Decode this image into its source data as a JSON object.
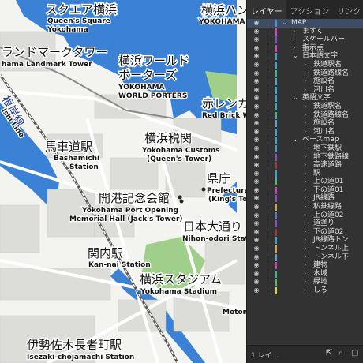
{
  "map": {
    "labels": [
      {
        "id": "queens-square-jp",
        "text": "スクエア横浜",
        "cls": "jp"
      },
      {
        "id": "queens-square-en",
        "text": "Queen's Square",
        "cls": "en"
      },
      {
        "id": "queens-square-en2",
        "text": "Yokohama",
        "cls": "en"
      },
      {
        "id": "landmark-jp",
        "text": "ランドマークタワー",
        "cls": "jp"
      },
      {
        "id": "landmark-en",
        "text": "hama Landmark Tower",
        "cls": "en"
      },
      {
        "id": "world-porters-jp",
        "text": "横浜ワールド",
        "cls": "jp"
      },
      {
        "id": "world-porters-jp2",
        "text": "ポーターズ",
        "cls": "jp"
      },
      {
        "id": "world-porters-en",
        "text": "YOKOHAMA",
        "cls": "en"
      },
      {
        "id": "world-porters-en2",
        "text": "WORLD PORTERS",
        "cls": "en"
      },
      {
        "id": "hammer-jp",
        "text": "横浜ハン",
        "cls": "jp"
      },
      {
        "id": "hammer-en",
        "text": "YOKOHAMA HAN",
        "cls": "en"
      },
      {
        "id": "redbrick-jp",
        "text": "赤レンガ",
        "cls": "jp"
      },
      {
        "id": "redbrick-en",
        "text": "Red Brick W",
        "cls": "en"
      },
      {
        "id": "line-jp",
        "text": "根岸線",
        "cls": "line"
      },
      {
        "id": "line-en",
        "text": "ishi Line",
        "cls": "en"
      },
      {
        "id": "bashamichi-jp",
        "text": "馬車道駅",
        "cls": "jp"
      },
      {
        "id": "bashamichi-en",
        "text": "Bashamichi",
        "cls": "en"
      },
      {
        "id": "bashamichi-en2",
        "text": "Station",
        "cls": "en"
      },
      {
        "id": "customs-jp",
        "text": "横浜税関",
        "cls": "jp"
      },
      {
        "id": "customs-en",
        "text": "Yokohama Customs",
        "cls": "en"
      },
      {
        "id": "customs-en2",
        "text": "(Queen's Tower)",
        "cls": "en"
      },
      {
        "id": "pref-jp",
        "text": "県庁",
        "cls": "jp"
      },
      {
        "id": "pref-en",
        "text": "Prefectura",
        "cls": "en"
      },
      {
        "id": "pref-en2",
        "text": "(King's Tow",
        "cls": "en"
      },
      {
        "id": "memorial-jp",
        "text": "開港記念会館",
        "cls": "jp"
      },
      {
        "id": "memorial-en",
        "text": "Yokohama Port Opening",
        "cls": "en"
      },
      {
        "id": "memorial-en2",
        "text": "Memorial Hall (Jack's Tower)",
        "cls": "en"
      },
      {
        "id": "nihon-odori-jp",
        "text": "日本大通り",
        "cls": "jp"
      },
      {
        "id": "nihon-odori-en",
        "text": "Nihon-odori Station",
        "cls": "en"
      },
      {
        "id": "kannai-jp",
        "text": "関内駅",
        "cls": "jp"
      },
      {
        "id": "kannai-en",
        "text": "Kan-nai Station",
        "cls": "en"
      },
      {
        "id": "stadium-jp",
        "text": "横浜スタジアム",
        "cls": "jp"
      },
      {
        "id": "stadium-en",
        "text": "Yokohama Stadium",
        "cls": "en"
      },
      {
        "id": "isezaki-jp",
        "text": "伊勢佐木長者町駅",
        "cls": "jp"
      },
      {
        "id": "isezaki-en",
        "text": "Isezaki-chojamachi Station",
        "cls": "en"
      },
      {
        "id": "motomachi-en",
        "text": "Motom",
        "cls": "en"
      }
    ]
  },
  "panel": {
    "tabs": [
      "レイヤー",
      "アクション",
      "リンク"
    ],
    "layers": [
      {
        "name": "MAP",
        "level": 0,
        "expanded": true,
        "color": "#4a90e2",
        "selected": true
      },
      {
        "name": "ますく",
        "level": 1,
        "color": "#e23bd0"
      },
      {
        "name": "スケールバー",
        "level": 1,
        "color": "#8a4bd6"
      },
      {
        "name": "指示点",
        "level": 1,
        "color": "#d93ec1"
      },
      {
        "name": "日本語文字",
        "level": 1,
        "expanded": true,
        "color": "#2fa8d8"
      },
      {
        "name": "鉄道駅名",
        "level": 2,
        "color": "#2fa8d8"
      },
      {
        "name": "鉄道路線名",
        "level": 2,
        "color": "#2fbf8f"
      },
      {
        "name": "施設名",
        "level": 2,
        "color": "#5aa0e0"
      },
      {
        "name": "河川名",
        "level": 2,
        "color": "#2fa8d8"
      },
      {
        "name": "英語文字",
        "level": 1,
        "expanded": true,
        "color": "#2fa8d8"
      },
      {
        "name": "鉄道駅名",
        "level": 2,
        "color": "#2fa8d8"
      },
      {
        "name": "鉄道路線名",
        "level": 2,
        "color": "#2fbf8f"
      },
      {
        "name": "施設名",
        "level": 2,
        "color": "#5aa0e0"
      },
      {
        "name": "河川名",
        "level": 2,
        "color": "#2fa8d8"
      },
      {
        "name": "ベースmap",
        "level": 1,
        "expanded": true,
        "color": "#2fa8d8"
      },
      {
        "name": "地下鉄駅",
        "level": 2,
        "color": "#2fa8d8"
      },
      {
        "name": "地下鉄路線",
        "level": 2,
        "color": "#8a4bd6"
      },
      {
        "name": "高速道路",
        "level": 2,
        "color": "#b5332e"
      },
      {
        "name": "駅",
        "level": 2,
        "color": "#2fa8d8"
      },
      {
        "name": "上の道01",
        "level": 2,
        "color": "#4ac06b"
      },
      {
        "name": "下の道01",
        "level": 2,
        "color": "#d93ec1"
      },
      {
        "name": "JR線路",
        "level": 2,
        "color": "#8a4bd6"
      },
      {
        "name": "私鉄線路",
        "level": 2,
        "color": "#d9a23e"
      },
      {
        "name": "上の道02",
        "level": 2,
        "color": "#4a7fe2"
      },
      {
        "name": "道塗り",
        "level": 2,
        "color": "#8a4bd6"
      },
      {
        "name": "下の道02",
        "level": 2,
        "color": "#b5332e"
      },
      {
        "name": "JR線路トン",
        "level": 2,
        "color": "#2fa8d8"
      },
      {
        "name": "トンネル上",
        "level": 2,
        "color": "#d9a23e"
      },
      {
        "name": "トンネル下",
        "level": 2,
        "color": "#5aa0e0"
      },
      {
        "name": "建物",
        "level": 2,
        "color": "#d93ec1"
      },
      {
        "name": "水域",
        "level": 2,
        "color": "#2fbf8f"
      },
      {
        "name": "緑地",
        "level": 2,
        "color": "#4ac06b"
      },
      {
        "name": "しろ",
        "level": 2,
        "color": "#e2d23b"
      }
    ],
    "footer": {
      "count": "1 レイ..."
    }
  }
}
